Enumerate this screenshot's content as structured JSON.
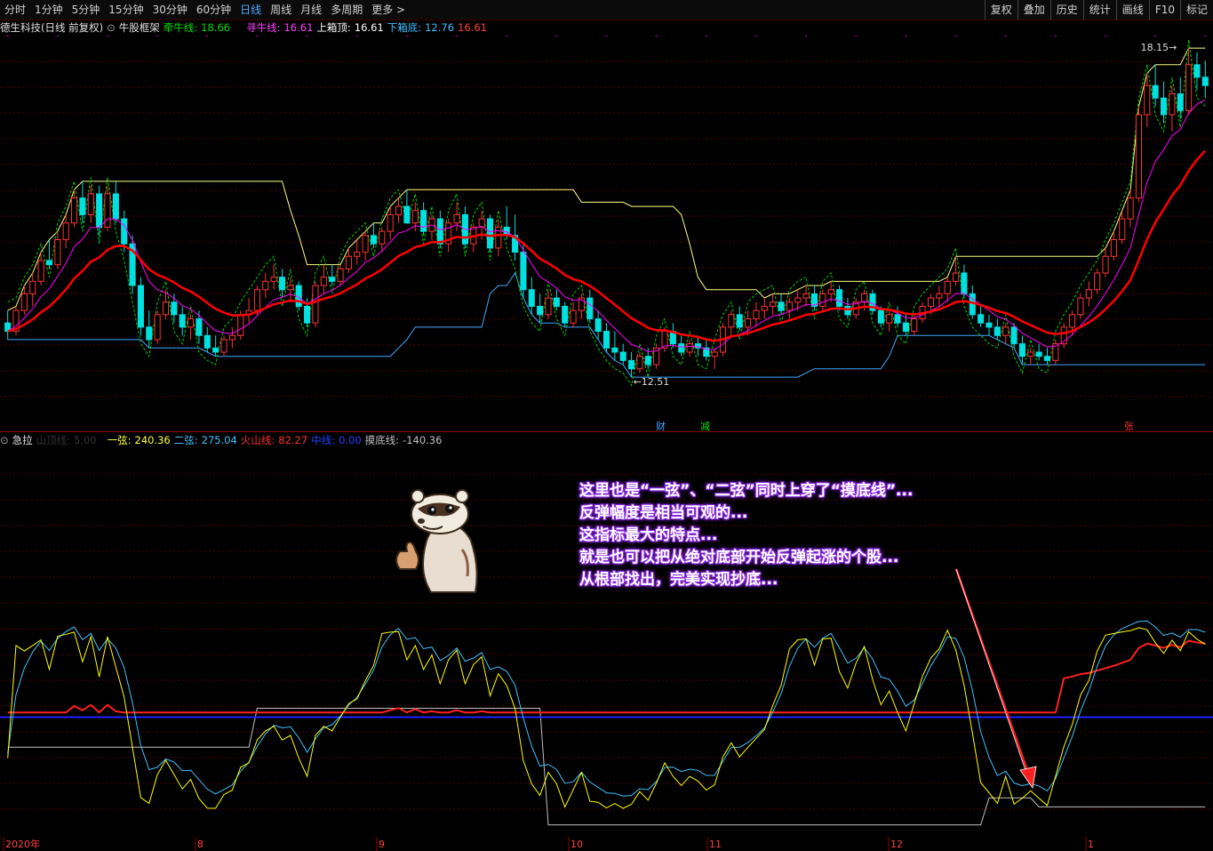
{
  "toolbar": {
    "periods": [
      "分时",
      "1分钟",
      "5分钟",
      "15分钟",
      "30分钟",
      "60分钟",
      "日线",
      "周线",
      "月线",
      "多周期",
      "更多 >"
    ],
    "active_period": "日线",
    "right_buttons": [
      "复权",
      "叠加",
      "历史",
      "统计",
      "画线",
      "F10",
      "标记"
    ]
  },
  "main_legend": {
    "stock": "德生科技(日线 前复权)",
    "indicator": "牛股框架",
    "qianniu_label": "牵牛线:",
    "qianniu_value": "18.66",
    "xunniu_label": "寻牛线:",
    "xunniu_value": "16.61",
    "top_label": "上箱顶:",
    "top_value": "16.61",
    "bottom_label": "下箱底:",
    "bottom_value": "12.76",
    "extra_value": "16.61"
  },
  "sub_legend": {
    "name": "急拉",
    "shan_label": "山顶线:",
    "shan_value": "5.00",
    "yixian_label": "一弦:",
    "yixian_value": "240.36",
    "erxian_label": "二弦:",
    "erxian_value": "275.04",
    "huoshan_label": "火山线:",
    "huoshan_value": "82.27",
    "zhong_label": "中线:",
    "zhong_value": "0.00",
    "modi_label": "摸底线:",
    "modi_value": "-140.36"
  },
  "markers": {
    "cai": "财",
    "jian": "减",
    "zhang": "张"
  },
  "annotation": {
    "lines": [
      "这里也是“一弦”、“二弦”同时上穿了“摸底线”...",
      "反弹幅度是相当可观的...",
      "这指标最大的特点...",
      "就是也可以把从绝对底部开始反弹起涨的个股...",
      "从根部找出，完美实现抄底..."
    ]
  },
  "colors": {
    "up": "#ff3232",
    "down": "#00e0e0",
    "qianniu": "#ff0000",
    "xunniu": "#ff00ff",
    "upper_box": "#ffff80",
    "lower_box": "#40a8ff",
    "dashed": "#00d000",
    "yixian": "#ffff00",
    "erxian": "#40c0ff",
    "huoshan": "#ff2020",
    "zhong": "#2020ff",
    "modi": "#c0c0c0"
  },
  "chart_data": [
    {
      "type": "candlestick",
      "title": "德生科技(日线 前复权)",
      "x_axis": [
        "2020年",
        "8",
        "9",
        "10",
        "11",
        "12",
        "1"
      ],
      "labels": {
        "high": "18.15",
        "low": "12.51"
      },
      "ylim": [
        11.0,
        20.5
      ],
      "series": [
        {
          "name": "牵牛线",
          "last": 18.66
        },
        {
          "name": "寻牛线",
          "last": 16.61
        },
        {
          "name": "上箱顶",
          "last": 16.61
        },
        {
          "name": "下箱底",
          "last": 12.76
        }
      ],
      "candles": [
        [
          13.6,
          13.9,
          13.2,
          13.4
        ],
        [
          13.4,
          14.0,
          13.3,
          13.9
        ],
        [
          13.9,
          14.5,
          13.8,
          14.3
        ],
        [
          14.3,
          14.8,
          14.0,
          14.6
        ],
        [
          14.6,
          15.3,
          14.5,
          15.1
        ],
        [
          15.1,
          15.6,
          14.9,
          15.0
        ],
        [
          15.0,
          15.8,
          14.9,
          15.6
        ],
        [
          15.6,
          16.2,
          15.4,
          16.0
        ],
        [
          16.0,
          16.8,
          15.9,
          16.6
        ],
        [
          16.6,
          17.0,
          16.0,
          16.2
        ],
        [
          16.2,
          16.9,
          16.0,
          16.7
        ],
        [
          16.7,
          16.9,
          15.7,
          15.9
        ],
        [
          15.9,
          16.9,
          15.8,
          16.7
        ],
        [
          16.7,
          17.0,
          16.0,
          16.1
        ],
        [
          16.1,
          16.3,
          15.3,
          15.5
        ],
        [
          15.5,
          15.7,
          14.3,
          14.5
        ],
        [
          14.5,
          14.7,
          13.3,
          13.5
        ],
        [
          13.5,
          13.9,
          13.0,
          13.2
        ],
        [
          13.2,
          13.9,
          13.1,
          13.8
        ],
        [
          13.8,
          14.4,
          13.7,
          14.1
        ],
        [
          14.1,
          14.3,
          13.6,
          13.8
        ],
        [
          13.8,
          14.0,
          13.3,
          13.5
        ],
        [
          13.5,
          13.8,
          13.2,
          13.7
        ],
        [
          13.7,
          13.9,
          13.1,
          13.3
        ],
        [
          13.3,
          13.5,
          12.9,
          13.0
        ],
        [
          13.0,
          13.3,
          12.8,
          12.9
        ],
        [
          12.9,
          13.3,
          12.8,
          13.2
        ],
        [
          13.2,
          13.5,
          13.0,
          13.3
        ],
        [
          13.3,
          13.9,
          13.2,
          13.8
        ],
        [
          13.8,
          14.2,
          13.6,
          13.9
        ],
        [
          13.9,
          14.5,
          13.8,
          14.4
        ],
        [
          14.4,
          14.8,
          14.2,
          14.6
        ],
        [
          14.6,
          15.0,
          14.4,
          14.7
        ],
        [
          14.7,
          14.9,
          14.2,
          14.4
        ],
        [
          14.4,
          14.7,
          14.1,
          14.5
        ],
        [
          14.5,
          14.6,
          13.9,
          14.0
        ],
        [
          14.0,
          14.2,
          13.5,
          13.6
        ],
        [
          13.6,
          14.6,
          13.5,
          14.5
        ],
        [
          14.5,
          15.0,
          14.3,
          14.7
        ],
        [
          14.7,
          15.0,
          14.5,
          14.6
        ],
        [
          14.6,
          15.0,
          14.5,
          14.9
        ],
        [
          14.9,
          15.4,
          14.8,
          15.2
        ],
        [
          15.2,
          15.6,
          15.0,
          15.3
        ],
        [
          15.3,
          15.8,
          15.1,
          15.7
        ],
        [
          15.7,
          16.0,
          15.4,
          15.5
        ],
        [
          15.5,
          15.9,
          15.3,
          15.8
        ],
        [
          15.8,
          16.4,
          15.6,
          16.2
        ],
        [
          16.2,
          16.6,
          16.0,
          16.4
        ],
        [
          16.4,
          16.8,
          16.2,
          16.0
        ],
        [
          16.0,
          16.5,
          15.8,
          16.3
        ],
        [
          16.3,
          16.5,
          15.7,
          15.8
        ],
        [
          15.8,
          16.2,
          15.6,
          16.1
        ],
        [
          16.1,
          16.3,
          15.4,
          15.5
        ],
        [
          15.5,
          16.1,
          15.3,
          16.0
        ],
        [
          16.0,
          16.5,
          15.8,
          16.2
        ],
        [
          16.2,
          16.4,
          15.4,
          15.5
        ],
        [
          15.5,
          16.0,
          15.3,
          15.9
        ],
        [
          15.9,
          16.3,
          15.6,
          16.1
        ],
        [
          16.1,
          16.2,
          15.3,
          15.4
        ],
        [
          15.4,
          16.1,
          15.2,
          15.9
        ],
        [
          15.9,
          16.4,
          15.6,
          15.7
        ],
        [
          15.7,
          16.2,
          15.1,
          15.3
        ],
        [
          15.3,
          15.5,
          14.2,
          14.4
        ],
        [
          14.4,
          14.7,
          13.8,
          14.0
        ],
        [
          14.0,
          14.3,
          13.6,
          13.8
        ],
        [
          13.8,
          14.4,
          13.7,
          14.2
        ],
        [
          14.2,
          14.4,
          13.9,
          14.0
        ],
        [
          14.0,
          14.1,
          13.5,
          13.6
        ],
        [
          13.6,
          14.1,
          13.5,
          13.9
        ],
        [
          13.9,
          14.3,
          13.7,
          14.2
        ],
        [
          14.2,
          14.4,
          13.6,
          13.7
        ],
        [
          13.7,
          13.9,
          13.2,
          13.4
        ],
        [
          13.4,
          13.6,
          12.9,
          13.0
        ],
        [
          13.0,
          13.4,
          12.7,
          12.9
        ],
        [
          12.9,
          13.1,
          12.6,
          12.7
        ],
        [
          12.7,
          12.9,
          12.3,
          12.5
        ],
        [
          12.5,
          12.9,
          12.4,
          12.8
        ],
        [
          12.8,
          13.0,
          12.5,
          12.6
        ],
        [
          12.6,
          13.1,
          12.5,
          13.0
        ],
        [
          13.0,
          13.5,
          12.9,
          13.4
        ],
        [
          13.4,
          13.6,
          13.0,
          13.1
        ],
        [
          13.1,
          13.3,
          12.8,
          12.9
        ],
        [
          12.9,
          13.2,
          12.8,
          13.1
        ],
        [
          13.1,
          13.3,
          12.8,
          13.0
        ],
        [
          13.0,
          13.2,
          12.7,
          12.8
        ],
        [
          12.8,
          13.0,
          12.5,
          12.9
        ],
        [
          12.9,
          13.6,
          12.8,
          13.5
        ],
        [
          13.5,
          13.9,
          13.3,
          13.8
        ],
        [
          13.8,
          14.0,
          13.4,
          13.5
        ],
        [
          13.5,
          13.9,
          13.3,
          13.7
        ],
        [
          13.7,
          14.1,
          13.5,
          13.9
        ],
        [
          13.9,
          14.2,
          13.7,
          14.0
        ],
        [
          14.0,
          14.3,
          13.8,
          14.1
        ],
        [
          14.1,
          14.3,
          13.8,
          13.9
        ],
        [
          13.9,
          14.2,
          13.7,
          14.1
        ],
        [
          14.1,
          14.4,
          13.9,
          14.2
        ],
        [
          14.2,
          14.5,
          14.0,
          14.3
        ],
        [
          14.3,
          14.5,
          13.9,
          14.0
        ],
        [
          14.0,
          14.4,
          13.9,
          14.3
        ],
        [
          14.3,
          14.6,
          14.1,
          14.4
        ],
        [
          14.4,
          14.5,
          13.9,
          14.0
        ],
        [
          14.0,
          14.2,
          13.7,
          13.8
        ],
        [
          13.8,
          14.2,
          13.7,
          14.1
        ],
        [
          14.1,
          14.4,
          13.9,
          14.3
        ],
        [
          14.3,
          14.4,
          13.8,
          13.9
        ],
        [
          13.9,
          14.0,
          13.5,
          13.6
        ],
        [
          13.6,
          13.9,
          13.4,
          13.8
        ],
        [
          13.8,
          14.0,
          13.5,
          13.6
        ],
        [
          13.6,
          13.8,
          13.3,
          13.4
        ],
        [
          13.4,
          13.8,
          13.3,
          13.7
        ],
        [
          13.7,
          14.1,
          13.6,
          14.0
        ],
        [
          14.0,
          14.3,
          13.8,
          14.2
        ],
        [
          14.2,
          14.5,
          14.0,
          14.3
        ],
        [
          14.3,
          14.7,
          14.1,
          14.6
        ],
        [
          14.6,
          15.2,
          14.5,
          14.8
        ],
        [
          14.8,
          15.0,
          14.2,
          14.3
        ],
        [
          14.3,
          14.5,
          13.7,
          13.8
        ],
        [
          13.8,
          14.0,
          13.5,
          13.6
        ],
        [
          13.6,
          13.8,
          13.3,
          13.5
        ],
        [
          13.5,
          13.7,
          13.2,
          13.3
        ],
        [
          13.3,
          13.6,
          13.1,
          13.5
        ],
        [
          13.5,
          13.6,
          13.0,
          13.1
        ],
        [
          13.1,
          13.3,
          12.6,
          12.8
        ],
        [
          12.8,
          13.0,
          12.6,
          12.9
        ],
        [
          12.9,
          13.1,
          12.7,
          12.8
        ],
        [
          12.8,
          13.0,
          12.6,
          12.7
        ],
        [
          12.7,
          13.2,
          12.6,
          13.1
        ],
        [
          13.1,
          13.6,
          13.0,
          13.5
        ],
        [
          13.5,
          13.9,
          13.3,
          13.8
        ],
        [
          13.8,
          14.3,
          13.7,
          14.2
        ],
        [
          14.2,
          14.6,
          14.0,
          14.4
        ],
        [
          14.4,
          14.9,
          14.3,
          14.8
        ],
        [
          14.8,
          15.4,
          14.7,
          15.2
        ],
        [
          15.2,
          15.8,
          15.1,
          15.6
        ],
        [
          15.6,
          16.3,
          15.5,
          16.1
        ],
        [
          16.1,
          16.8,
          15.9,
          16.6
        ],
        [
          16.6,
          18.8,
          16.5,
          18.6
        ],
        [
          18.6,
          19.6,
          18.3,
          19.3
        ],
        [
          19.3,
          19.8,
          18.8,
          19.0
        ],
        [
          19.0,
          19.4,
          18.4,
          18.6
        ],
        [
          18.6,
          19.3,
          18.2,
          19.1
        ],
        [
          19.1,
          19.5,
          18.5,
          18.7
        ],
        [
          18.7,
          20.2,
          18.6,
          19.8
        ],
        [
          19.8,
          20.1,
          19.2,
          19.5
        ],
        [
          19.5,
          19.9,
          19.0,
          19.3
        ]
      ]
    },
    {
      "type": "line",
      "title": "急拉",
      "ylim": [
        -200,
        450
      ],
      "series": [
        {
          "name": "一弦",
          "last": 240.36
        },
        {
          "name": "二弦",
          "last": 275.04
        },
        {
          "name": "火山线",
          "last": 82.27
        },
        {
          "name": "中线",
          "last": 0.0
        },
        {
          "name": "摸底线",
          "last": -140.36
        }
      ]
    }
  ]
}
